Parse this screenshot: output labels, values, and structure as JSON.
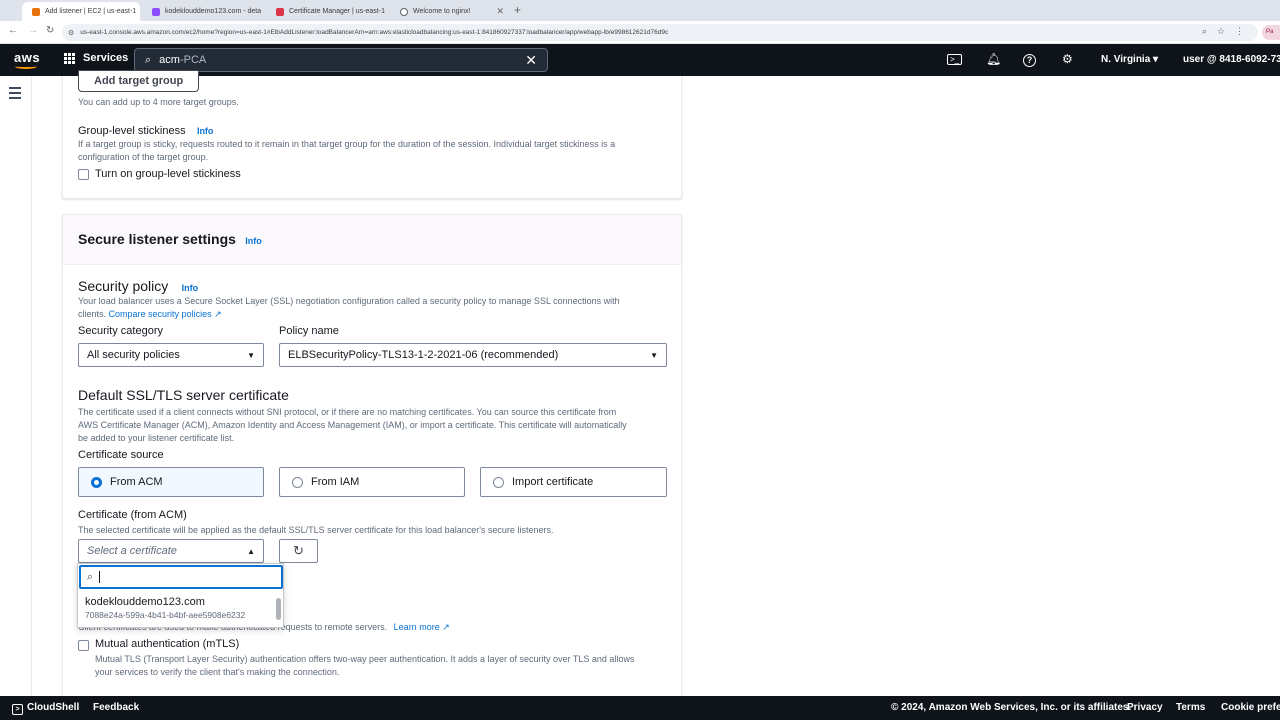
{
  "browser": {
    "tabs": [
      {
        "title": "Add listener | EC2 | us-east-1",
        "color": "#e8730a",
        "active": true
      },
      {
        "title": "kodeklouddemo123.com - deta",
        "color": "#8c4fff",
        "active": false
      },
      {
        "title": "Certificate Manager | us-east-1",
        "color": "#dd344c",
        "active": false
      },
      {
        "title": "Welcome to nginx!",
        "color": "#5f6368",
        "active": false
      }
    ],
    "url": "us-east-1.console.aws.amazon.com/ec2/home?region=us-east-1#ElbAddListener:loadBalancerArn=arn:aws:elasticloadbalancing:us-east-1:841860927337:loadbalancer/app/webapp-lb/e998612621d76d9c",
    "profile_label": "Pa"
  },
  "topnav": {
    "logo": "aws",
    "services_label": "Services",
    "search_value": "acm",
    "search_suffix": "-PCA",
    "region": "N. Virginia ▾",
    "user": "user @ 8418-6092-733"
  },
  "target_groups": {
    "add_button": "Add target group",
    "hint": "You can add up to 4 more target groups.",
    "stickiness_label": "Group-level stickiness",
    "info": "Info",
    "stickiness_desc_1": "If a target group is sticky, requests routed to it remain in that target group for the duration of the session. Individual target stickiness is a",
    "stickiness_desc_2": "configuration of the target group.",
    "stickiness_checkbox": "Turn on group-level stickiness"
  },
  "secure_listener": {
    "title": "Secure listener settings",
    "info": "Info",
    "security_policy": {
      "title": "Security policy",
      "info": "Info",
      "desc_1": "Your load balancer uses a Secure Socket Layer (SSL) negotiation configuration called a security policy to manage SSL connections with",
      "desc_2": "clients.",
      "compare_link": "Compare security policies",
      "category_label": "Security category",
      "category_value": "All security policies",
      "policy_label": "Policy name",
      "policy_value": "ELBSecurityPolicy-TLS13-1-2-2021-06 (recommended)"
    },
    "default_cert": {
      "title": "Default SSL/TLS server certificate",
      "desc_1": "The certificate used if a client connects without SNI protocol, or if there are no matching certificates. You can source this certificate from",
      "desc_2": "AWS Certificate Manager (ACM), Amazon Identity and Access Management (IAM), or import a certificate. This certificate will automatically",
      "desc_3": "be added to your listener certificate list.",
      "source_label": "Certificate source",
      "sources": [
        "From ACM",
        "From IAM",
        "Import certificate"
      ],
      "acm_label": "Certificate (from ACM)",
      "acm_desc": "The selected certificate will be applied as the default SSL/TLS server certificate for this load balancer's secure listeners.",
      "select_placeholder": "Select a certificate",
      "dropdown_search_value": "",
      "option_name": "kodeklouddemo123.com",
      "option_id": "7088e24a-599a-4b41-b4bf-aee5908e6232"
    },
    "client_cert": {
      "desc_visible": "Client certificates are used to make authenticated requests to remote servers.",
      "learn_more": "Learn more",
      "mtls_label": "Mutual authentication (mTLS)",
      "mtls_desc_1": "Mutual TLS (Transport Layer Security) authentication offers two-way peer authentication. It adds a layer of security over TLS and allows",
      "mtls_desc_2": "your services to verify the client that's making the connection."
    }
  },
  "footer": {
    "cloudshell": "CloudShell",
    "feedback": "Feedback",
    "copyright": "© 2024, Amazon Web Services, Inc. or its affiliates.",
    "privacy": "Privacy",
    "terms": "Terms",
    "cookies": "Cookie preferences"
  }
}
